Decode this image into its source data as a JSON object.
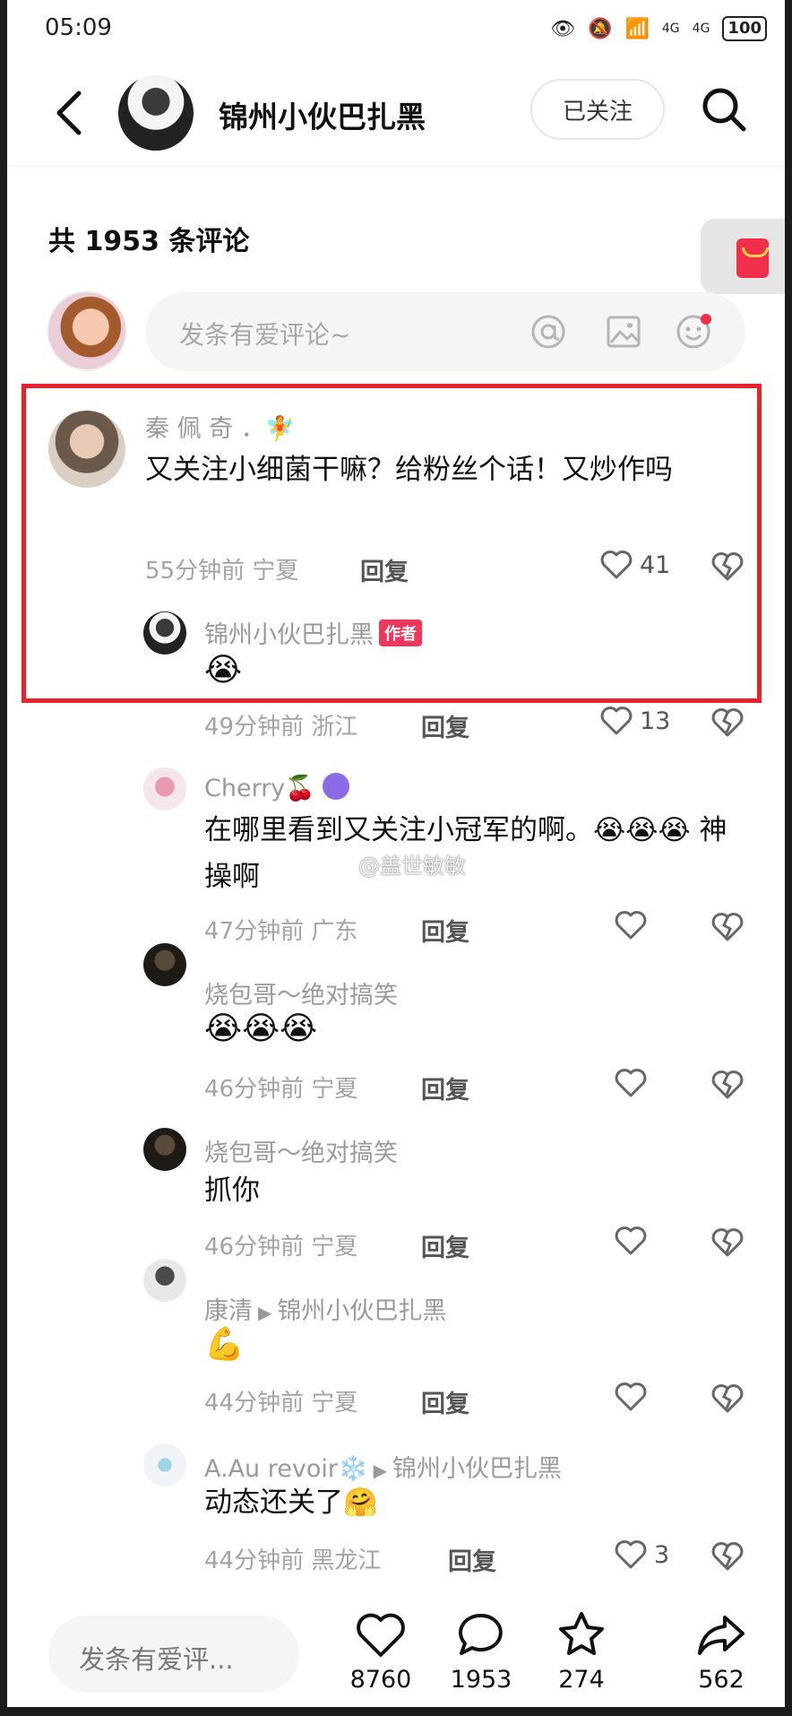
{
  "status_bar": {
    "time": "05:09",
    "network1": "4G",
    "network2": "4G",
    "battery": "100"
  },
  "header": {
    "name": "锦州小伙巴扎黑",
    "follow_label": "已关注"
  },
  "comments_header": {
    "count_label": "共 1953 条评论"
  },
  "input": {
    "placeholder": "发条有爱评论~"
  },
  "comments": [
    {
      "name": "秦 佩 奇 ．🧚",
      "text": "又关注小细菌干嘛？给粉丝个话！又炒作吗",
      "time_loc": "55分钟前  宁夏",
      "reply": "回复",
      "likes": "41"
    },
    {
      "name": "锦州小伙巴扎黑",
      "badge": "作者",
      "text": "😭",
      "time_loc": "49分钟前  浙江",
      "reply": "回复",
      "likes": "13"
    },
    {
      "name": "Cherry🍒",
      "text": "在哪里看到又关注小冠军的啊。😭😭😭 神操啊",
      "time_loc": "47分钟前  广东",
      "reply": "回复",
      "likes": ""
    },
    {
      "name": "烧包哥～绝对搞笑",
      "text": "😭😭😭",
      "time_loc": "46分钟前  宁夏",
      "reply": "回复",
      "likes": ""
    },
    {
      "name": "烧包哥～绝对搞笑",
      "text": "抓你",
      "time_loc": "46分钟前  宁夏",
      "reply": "回复",
      "likes": ""
    },
    {
      "name": "康清",
      "reply_to": "锦州小伙巴扎黑",
      "text": "💪",
      "time_loc": "44分钟前  宁夏",
      "reply": "回复",
      "likes": ""
    },
    {
      "name": "A.Au revoir❄️",
      "reply_to": "锦州小伙巴扎黑",
      "text": "动态还关了🤗",
      "time_loc": "44分钟前  黑龙江",
      "reply": "回复",
      "likes": "3"
    }
  ],
  "watermark": "@盖世敏敏",
  "bottom_bar": {
    "input_placeholder": "发条有爱评...",
    "likes": "8760",
    "comments": "1953",
    "favorites": "274",
    "shares": "562"
  },
  "colors": {
    "highlight": "#e8212a",
    "author_badge": "#f2355a",
    "accent_red": "#f22f4a"
  }
}
